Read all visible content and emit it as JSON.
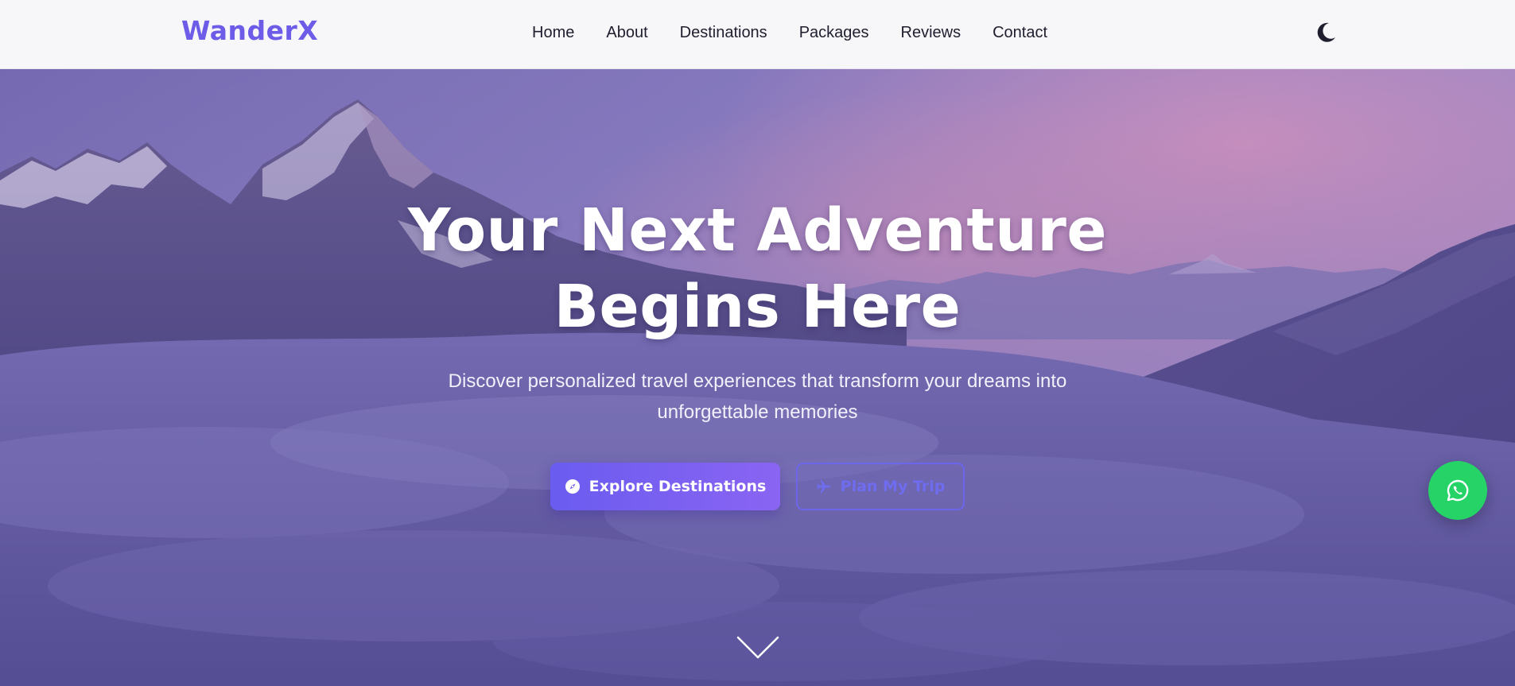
{
  "brand": {
    "name": "WanderX",
    "color": "#6c5ce7"
  },
  "nav": {
    "items": [
      {
        "label": "Home"
      },
      {
        "label": "About"
      },
      {
        "label": "Destinations"
      },
      {
        "label": "Packages"
      },
      {
        "label": "Reviews"
      },
      {
        "label": "Contact"
      }
    ],
    "theme_toggle_icon": "moon-icon"
  },
  "hero": {
    "title_line1": "Your Next Adventure",
    "title_line2": "Begins Here",
    "subtitle": "Discover personalized travel experiences that transform your dreams into unforgettable memories",
    "primary_button": {
      "label": "Explore Destinations",
      "icon": "compass-icon"
    },
    "secondary_button": {
      "label": "Plan My Trip",
      "icon": "plane-icon"
    },
    "scroll_icon": "chevron-down-icon",
    "background": "mountain-landscape-with-clouds"
  },
  "fab": {
    "icon": "whatsapp-icon",
    "color": "#25d366"
  },
  "colors": {
    "accent": "#6c5ce7",
    "button_gradient_start": "#6a5cf0",
    "button_gradient_end": "#8a64f2",
    "hero_overlay": "#5b5494"
  }
}
